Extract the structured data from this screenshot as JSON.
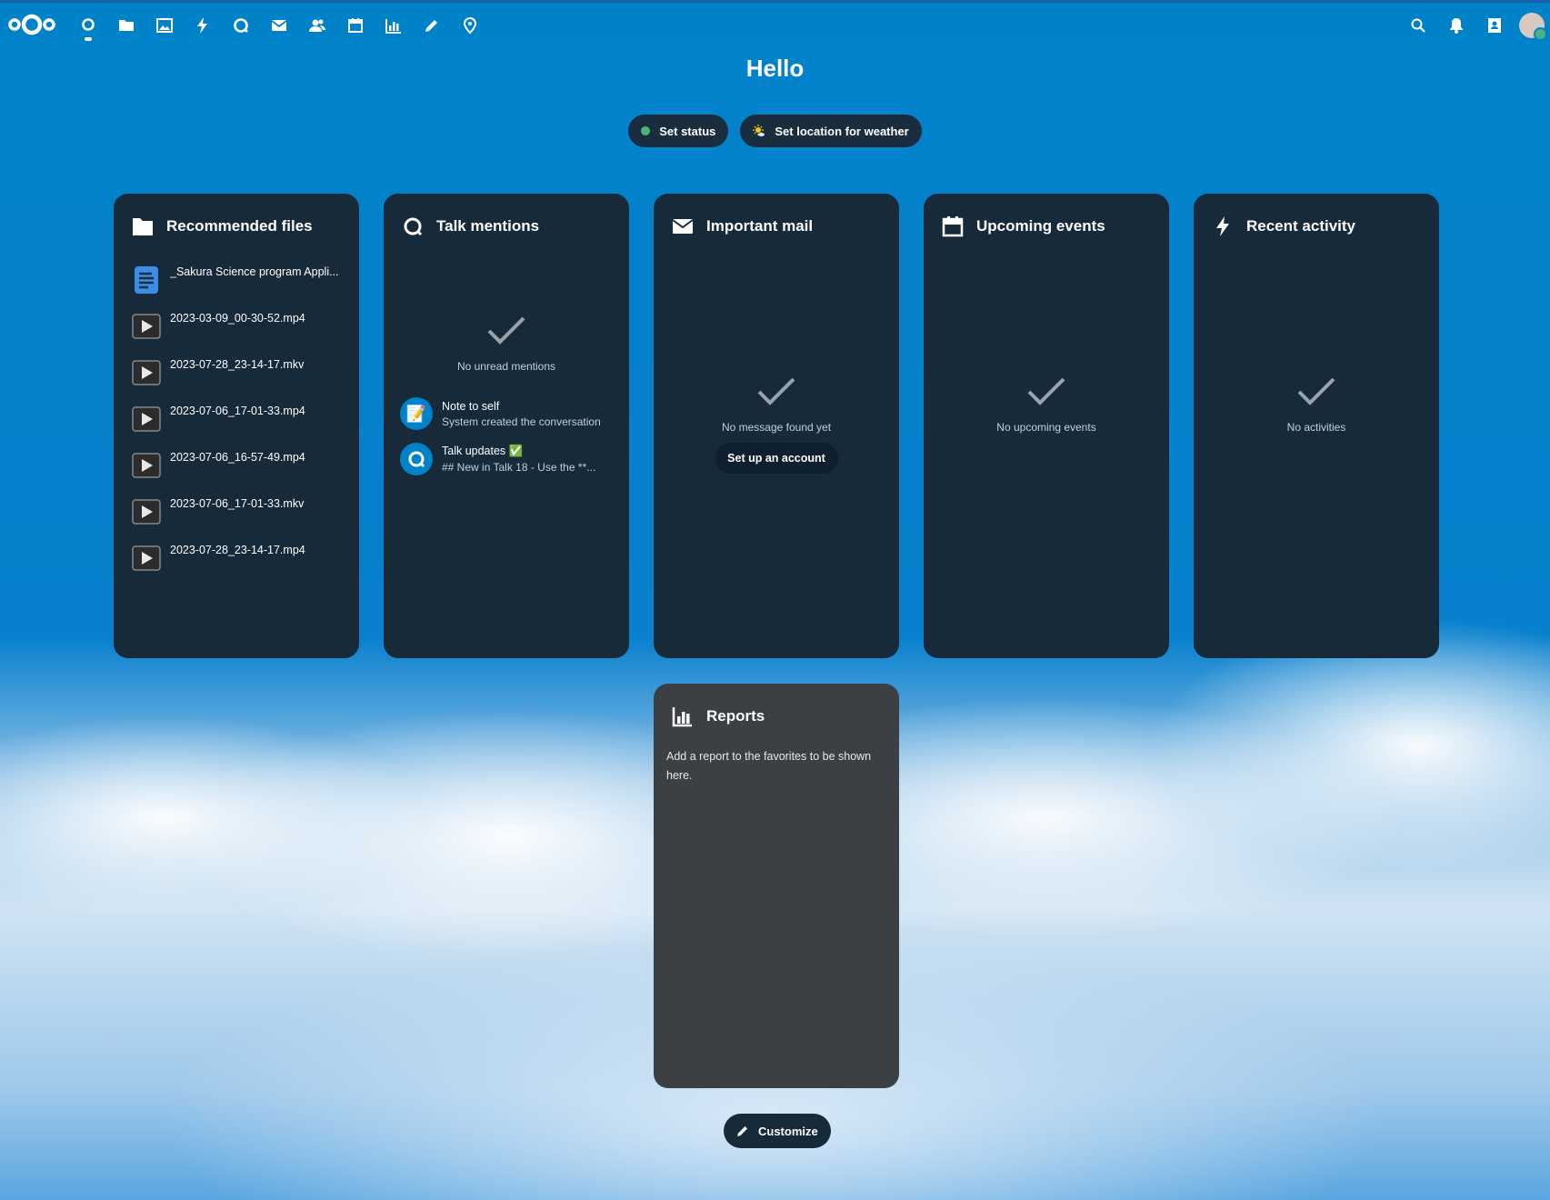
{
  "header": {
    "nav": [
      "dashboard-icon",
      "files-icon",
      "photos-icon",
      "activity-icon",
      "talk-icon",
      "mail-icon",
      "contacts-icon",
      "calendar-icon",
      "analytics-icon",
      "notes-icon",
      "maps-icon"
    ],
    "right": [
      "search-icon",
      "bell-icon",
      "contacts-menu-icon"
    ]
  },
  "greeting": "Hello",
  "status": {
    "set_status": "Set status",
    "weather": "Set location for weather"
  },
  "panels": {
    "files": {
      "title": "Recommended files",
      "items": [
        "_Sakura Science program Appli...",
        "2023-03-09_00-30-52.mp4",
        "2023-07-28_23-14-17.mkv",
        "2023-07-06_17-01-33.mp4",
        "2023-07-06_16-57-49.mp4",
        "2023-07-06_17-01-33.mkv",
        "2023-07-28_23-14-17.mp4"
      ]
    },
    "talk": {
      "title": "Talk mentions",
      "empty": "No unread mentions",
      "items": [
        {
          "title": "Note to self",
          "sub": "System created the conversation",
          "emoji": "📝"
        },
        {
          "title": "Talk updates ✅",
          "sub": "## New in Talk 18 - Use the **..."
        }
      ]
    },
    "mail": {
      "title": "Important mail",
      "empty": "No message found yet",
      "button": "Set up an account"
    },
    "events": {
      "title": "Upcoming events",
      "empty": "No upcoming events"
    },
    "activity": {
      "title": "Recent activity",
      "empty": "No activities"
    },
    "reports": {
      "title": "Reports",
      "text": "Add a report to the favorites to be shown here."
    }
  },
  "customize": "Customize"
}
